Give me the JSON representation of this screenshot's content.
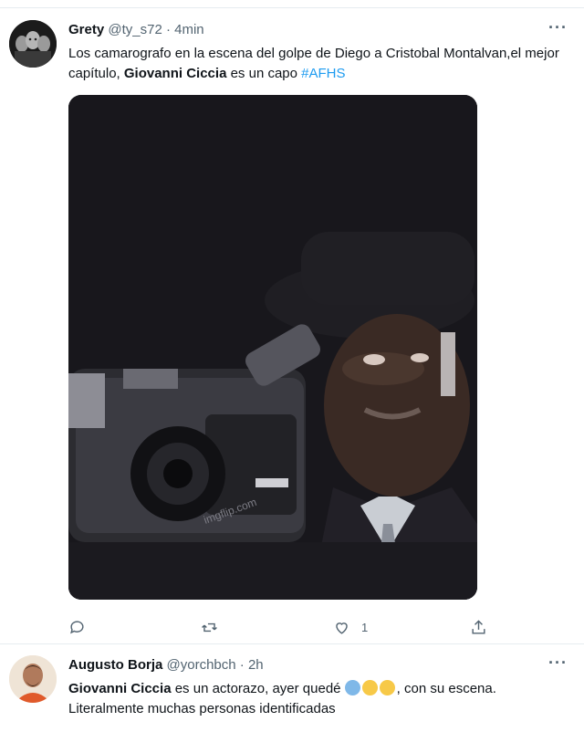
{
  "tweets": [
    {
      "name": "Grety",
      "handle": "@ty_s72",
      "separator": "·",
      "time": "4min",
      "text_parts": {
        "p1": "Los camarografo en la escena del golpe de  Diego a Cristobal Montalvan,el mejor capítulo,  ",
        "bold": "Giovanni Ciccia",
        "p2": " es un capo ",
        "hashtag": "#AFHS"
      },
      "media": {
        "description_icon": "video-thumbnail",
        "watermark": "imgflip.com"
      },
      "actions": {
        "reply_count": "",
        "retweet_count": "",
        "like_count": "1",
        "share_count": ""
      },
      "more": "···"
    },
    {
      "name": "Augusto Borja",
      "handle": "@yorchbch",
      "separator": "·",
      "time": "2h",
      "text_parts": {
        "bold": "Giovanni Ciccia",
        "p1": " es un actorazo, ayer quedé ",
        "p2": ", con su escena. Literalmente muchas personas identificadas"
      },
      "emojis": [
        "screaming-face-emoji",
        "hushed-face-emoji",
        "relieved-face-emoji"
      ],
      "more": "···"
    }
  ],
  "colors": {
    "link": "#1d9bf0",
    "secondary_text": "#536471",
    "border": "#e6ecf0"
  }
}
